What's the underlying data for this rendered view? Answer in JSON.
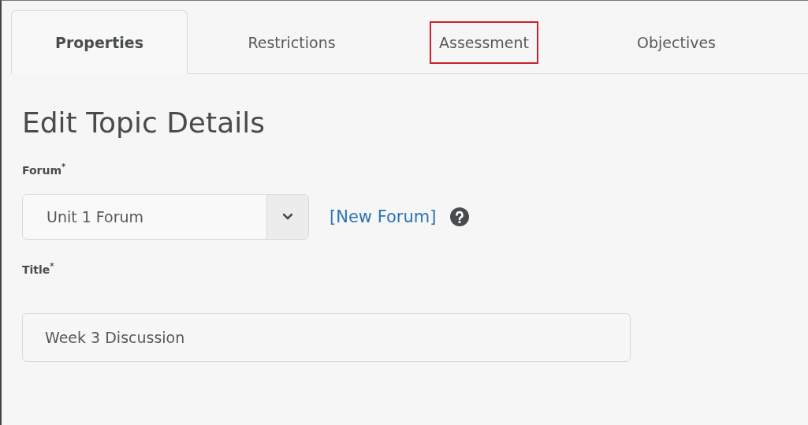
{
  "tabs": [
    {
      "label": "Properties",
      "selected": true,
      "highlighted": false
    },
    {
      "label": "Restrictions",
      "selected": false,
      "highlighted": false
    },
    {
      "label": "Assessment",
      "selected": false,
      "highlighted": true
    },
    {
      "label": "Objectives",
      "selected": false,
      "highlighted": false
    }
  ],
  "heading": "Edit Topic Details",
  "forum": {
    "label": "Forum$^{*}$",
    "value": "Unit 1 Forum",
    "link": "[New Forum]"
  },
  "title_field": {
    "label": "Title$^{*}$",
    "value": "Week 3 Discussion"
  }
}
